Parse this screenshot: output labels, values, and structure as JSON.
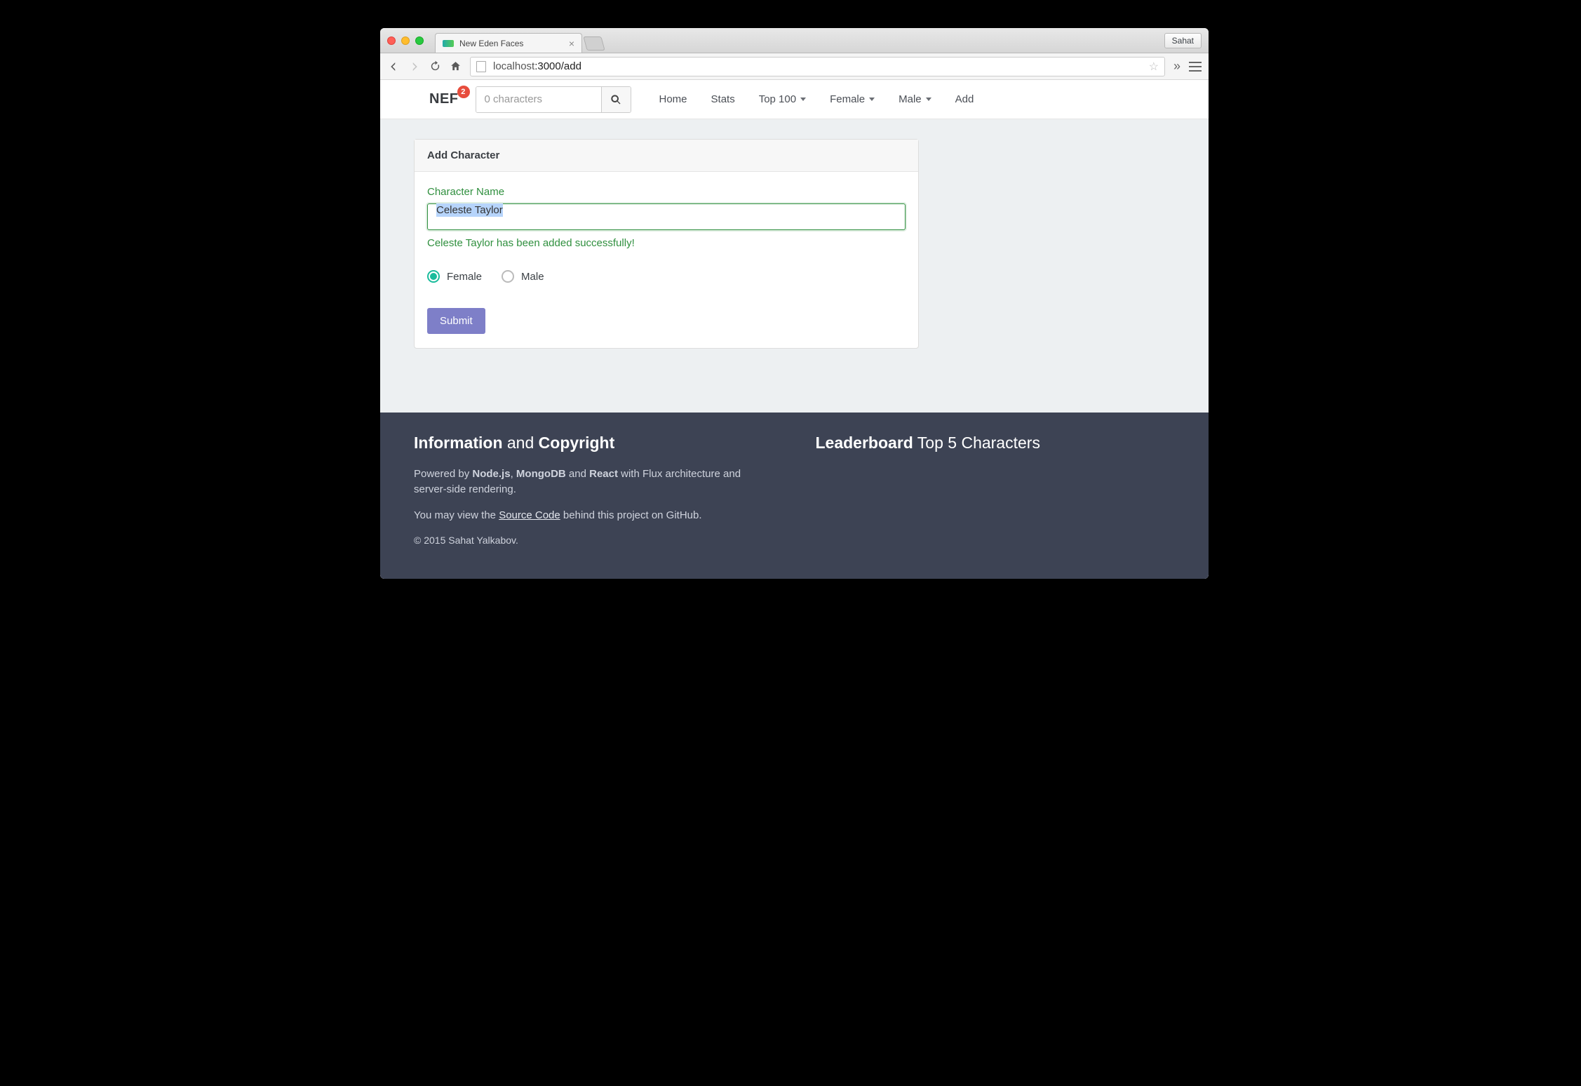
{
  "browser": {
    "tab_title": "New Eden Faces",
    "profile_name": "Sahat",
    "url_host": "localhost",
    "url_port_path": ":3000/add"
  },
  "navbar": {
    "brand": "NEF",
    "badge_count": "2",
    "search_placeholder": "0 characters",
    "items": [
      {
        "label": "Home",
        "dropdown": false
      },
      {
        "label": "Stats",
        "dropdown": false
      },
      {
        "label": "Top 100",
        "dropdown": true
      },
      {
        "label": "Female",
        "dropdown": true
      },
      {
        "label": "Male",
        "dropdown": true
      },
      {
        "label": "Add",
        "dropdown": false
      }
    ]
  },
  "panel": {
    "title": "Add Character",
    "name_label": "Character Name",
    "name_value": "Celeste Taylor",
    "success_message": "Celeste Taylor has been added successfully!",
    "gender": {
      "female": "Female",
      "male": "Male",
      "selected": "female"
    },
    "submit_label": "Submit"
  },
  "footer": {
    "info_heading_strong1": "Information",
    "info_heading_mid": " and ",
    "info_heading_strong2": "Copyright",
    "powered_prefix": "Powered by ",
    "tech1": "Node.js",
    "sep1": ", ",
    "tech2": "MongoDB",
    "sep2": " and ",
    "tech3": "React",
    "powered_suffix": " with Flux architecture and server-side rendering.",
    "source_prefix": "You may view the ",
    "source_link": "Source Code",
    "source_suffix": " behind this project on GitHub.",
    "copyright": "© 2015 Sahat Yalkabov.",
    "leaderboard_strong": "Leaderboard",
    "leaderboard_rest": " Top 5 Characters"
  }
}
